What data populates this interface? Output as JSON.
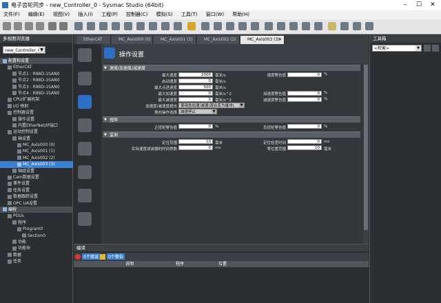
{
  "window": {
    "title": "电子齿轮同步 - new_Controller_0 - Sysmac Studio (64bit)"
  },
  "menu": [
    "文件(F)",
    "编辑(E)",
    "视图(V)",
    "插入(I)",
    "工程(P)",
    "控制器(C)",
    "模拟(S)",
    "工具(T)",
    "窗口(W)",
    "帮助(H)"
  ],
  "left_panel": {
    "header": "多视图浏览器",
    "controller": "new_Controller_0",
    "tree": [
      {
        "label": "配置和设置",
        "section": true,
        "indent": 0
      },
      {
        "label": "EtherCAT",
        "indent": 1
      },
      {
        "label": "节点1 : R88D-1SAN0",
        "indent": 2
      },
      {
        "label": "节点2 : R88D-1SAN0",
        "indent": 2
      },
      {
        "label": "节点3 : R88D-1SAN0",
        "indent": 2
      },
      {
        "label": "节点4 : R88D-1SAN0",
        "indent": 2
      },
      {
        "label": "CPU/扩展机架",
        "indent": 1
      },
      {
        "label": "I/O 映射",
        "indent": 1
      },
      {
        "label": "控制器设置",
        "indent": 1
      },
      {
        "label": "操作设置",
        "indent": 2
      },
      {
        "label": "内置EtherNet/IP端口",
        "indent": 2
      },
      {
        "label": "运动控制设置",
        "indent": 1
      },
      {
        "label": "轴设置",
        "indent": 2
      },
      {
        "label": "MC_Axis000 (0)",
        "indent": 3
      },
      {
        "label": "MC_Axis001 (1)",
        "indent": 3
      },
      {
        "label": "MC_Axis002 (2)",
        "indent": 3
      },
      {
        "label": "MC_Axis003 (3)",
        "indent": 3,
        "selected": true
      },
      {
        "label": "轴组设置",
        "indent": 2
      },
      {
        "label": "Cam数据设置",
        "indent": 1
      },
      {
        "label": "事件设置",
        "indent": 1
      },
      {
        "label": "任务设置",
        "indent": 1
      },
      {
        "label": "数据跟踪设置",
        "indent": 1
      },
      {
        "label": "OPC UA设置",
        "indent": 1
      },
      {
        "label": "编程",
        "section": true,
        "indent": 0
      },
      {
        "label": "POUs",
        "indent": 1
      },
      {
        "label": "程序",
        "indent": 2
      },
      {
        "label": "Program0",
        "indent": 3
      },
      {
        "label": "Section0",
        "indent": 4
      },
      {
        "label": "功能",
        "indent": 2
      },
      {
        "label": "功能块",
        "indent": 2
      },
      {
        "label": "数据",
        "indent": 1
      },
      {
        "label": "任务",
        "indent": 1
      }
    ]
  },
  "tabs": [
    {
      "label": "EtherCAT",
      "active": false
    },
    {
      "label": "MC_Axis000 (0)",
      "active": false
    },
    {
      "label": "MC_Axis001 (1)",
      "active": false
    },
    {
      "label": "MC_Axis002 (2)",
      "active": false
    },
    {
      "label": "MC_Axis003 (3)",
      "active": true
    }
  ],
  "page": {
    "title": "操作设置",
    "sections": {
      "velocity": "速度/加速度/减速度",
      "torque": "扭矩",
      "monitor": "监测"
    },
    "fields": {
      "max_velocity": {
        "label": "最大速度",
        "value": "2000",
        "unit": "毫米/s"
      },
      "start_velocity": {
        "label": "启动速度",
        "value": "0",
        "unit": "毫米/s"
      },
      "max_jog_velocity": {
        "label": "最大点进速度",
        "value": "500",
        "unit": "毫米/s"
      },
      "max_accel": {
        "label": "最大加速度",
        "value": "0",
        "unit": "毫米/s^2"
      },
      "max_decel": {
        "label": "最大减速度",
        "value": "0",
        "unit": "毫米/s^2"
      },
      "accel_exceed": {
        "label": "加速度/减速度超出",
        "value": "使用急加速/减速(混合变为缓冲)"
      },
      "reversal": {
        "label": "换向操作选择",
        "value": "减速停止"
      },
      "velocity_warn": {
        "label": "速度警告值",
        "value": "0",
        "unit": "%"
      },
      "accel_warn": {
        "label": "加速度警告值",
        "value": "0",
        "unit": "%"
      },
      "decel_warn": {
        "label": "减速度警告值",
        "value": "0",
        "unit": "%"
      },
      "pos_torque_warn": {
        "label": "正扭矩警告值",
        "value": "0",
        "unit": "%"
      },
      "neg_torque_warn": {
        "label": "负扭矩警告值",
        "value": "0",
        "unit": "%"
      },
      "in_pos_range": {
        "label": "定位范围",
        "value": "10",
        "unit": "毫米"
      },
      "in_pos_check_time": {
        "label": "定位检查时间",
        "value": "0",
        "unit": "ms"
      },
      "actual_vel_filter": {
        "label": "实际速度滤波器的时间常数",
        "value": "0",
        "unit": "ms"
      },
      "zero_pos_range": {
        "label": "零位置范围",
        "value": "10",
        "unit": "毫米"
      }
    }
  },
  "bottom_panel": {
    "header": "编译",
    "filter_errors": "0个错误",
    "filter_warnings": "0个警告",
    "columns": [
      "说明",
      "程序",
      "位置"
    ]
  },
  "right_panel": {
    "header": "工具箱",
    "search_placeholder": "<检索>"
  },
  "colors": {
    "accent": "#3f7fcf",
    "panel": "#2b2e33",
    "section": "#5a5f67"
  }
}
